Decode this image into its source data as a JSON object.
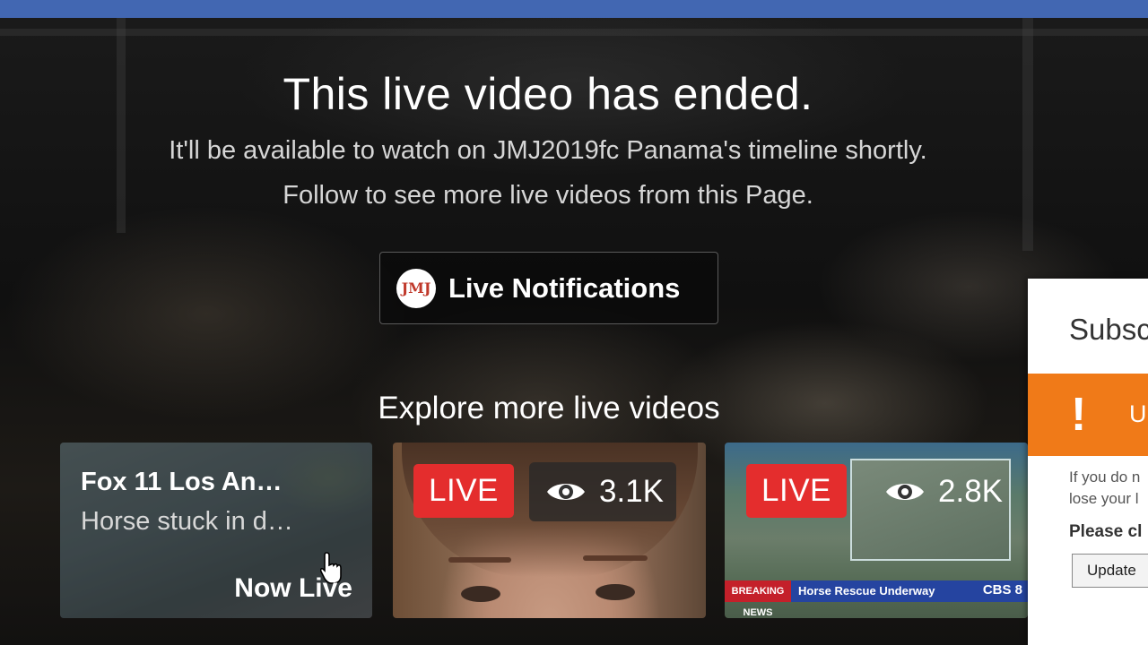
{
  "header": {
    "color": "#4267b2"
  },
  "video_ended": {
    "title": "This live video has ended.",
    "line1": "It'll be available to watch on JMJ2019fc Panama's timeline shortly.",
    "line2": "Follow to see more live videos from this Page."
  },
  "notifications_button": {
    "label": "Live Notifications",
    "avatar_text": "JMJ"
  },
  "explore": {
    "heading": "Explore more live videos",
    "cards": [
      {
        "title": "Fox 11 Los An…",
        "subtitle": "Horse stuck in d…",
        "status": "Now Live"
      },
      {
        "badge": "LIVE",
        "views": "3.1K"
      },
      {
        "badge": "LIVE",
        "views": "2.8K",
        "ticker_left": "BREAKING NEWS",
        "ticker_text": "Horse Rescue Underway",
        "ticker_logo": "CBS 8"
      }
    ]
  },
  "dialog": {
    "title": "Subsc",
    "warning_icon": "!",
    "warning_text": "U",
    "body_line1": "If you do n",
    "body_line2": "lose your l",
    "bold_text": "Please cl",
    "button_label": "Update",
    "accent_color": "#f07a18"
  },
  "colors": {
    "live_badge": "#e42d2d"
  }
}
